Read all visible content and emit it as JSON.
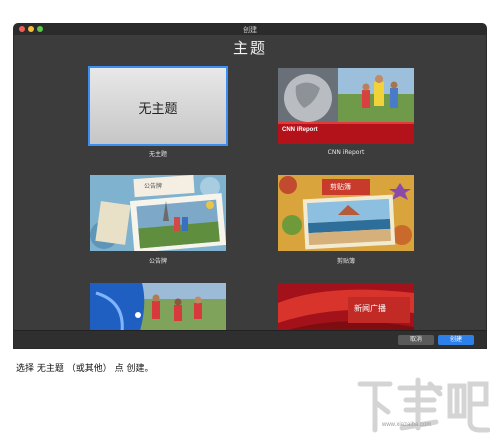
{
  "window": {
    "title": "创建",
    "heading": "主题"
  },
  "themes": [
    {
      "caption": "无主题",
      "thumb_text": "无主题",
      "selected": true
    },
    {
      "caption": "CNN iReport",
      "thumb_text": "CNN iReport"
    },
    {
      "caption": "公告牌",
      "thumb_text": "公告牌"
    },
    {
      "caption": "剪贴簿",
      "thumb_text": "剪贴簿"
    },
    {
      "caption": "",
      "thumb_text": ""
    },
    {
      "caption": "",
      "thumb_text": "新闻广播"
    }
  ],
  "buttons": {
    "cancel": "取消",
    "create": "创建"
  },
  "instruction": "选择 无主题 （或其他） 点 创建。",
  "watermark": {
    "logo_text": "下载吧",
    "url": "www.xiazaiba.com"
  },
  "colors": {
    "selection": "#3b8ff0",
    "create_button": "#2f7fe8",
    "window_bg": "#3c3c3c"
  }
}
